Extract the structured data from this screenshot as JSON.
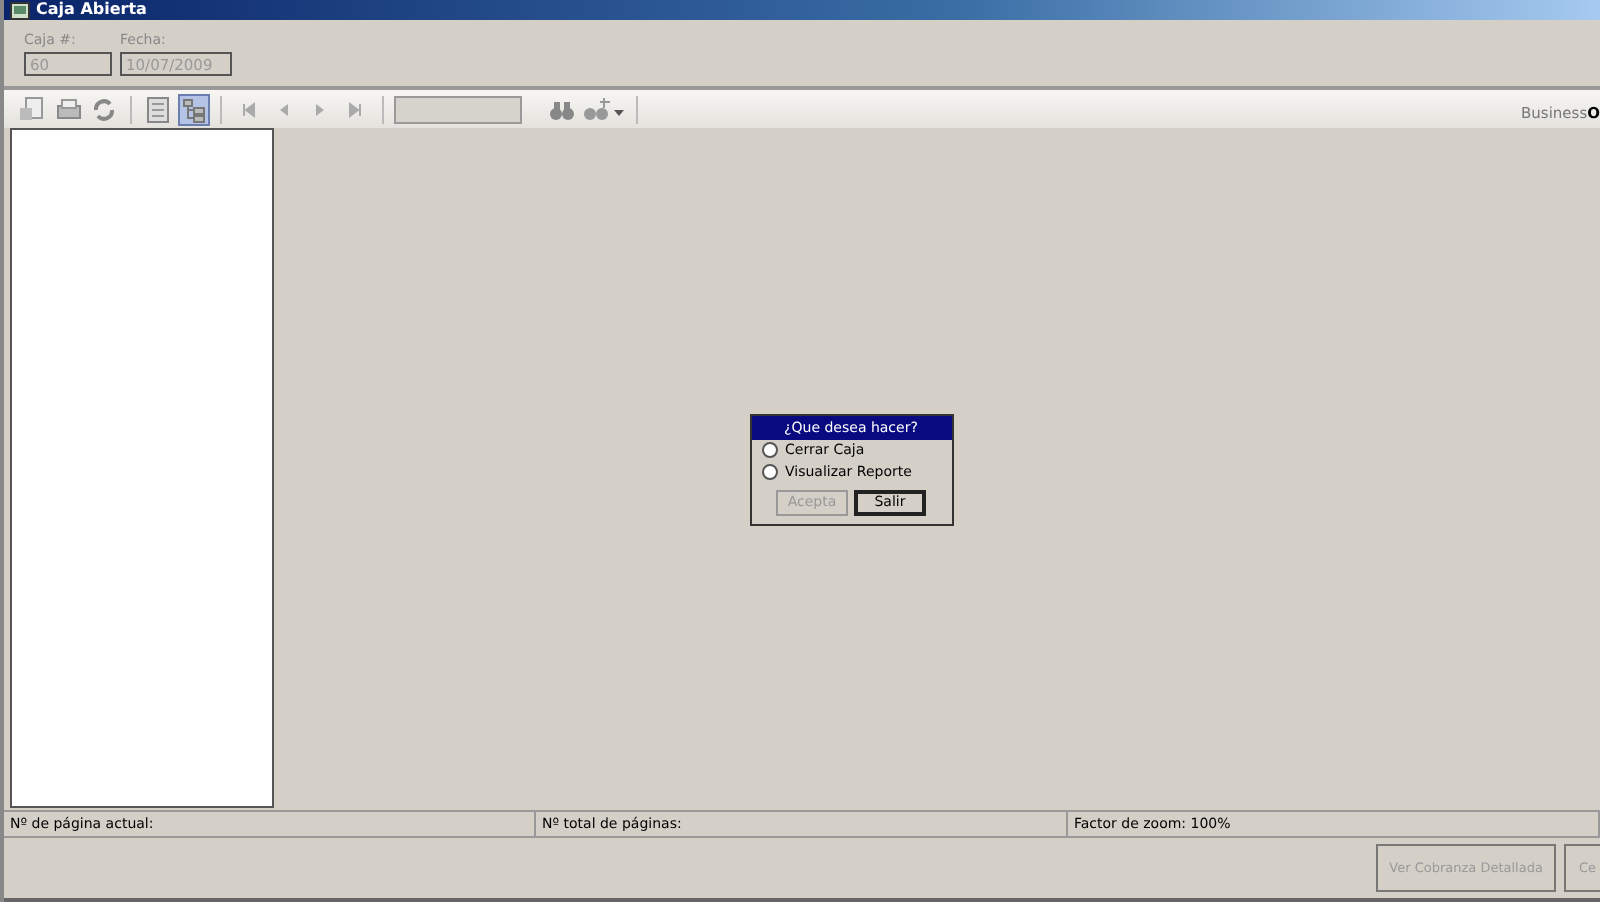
{
  "window": {
    "title": "Caja Abierta"
  },
  "header": {
    "fields": [
      {
        "label": "Caja #:",
        "value": "60"
      },
      {
        "label": "Fecha:",
        "value": "10/07/2009"
      }
    ]
  },
  "toolbar": {
    "groups": [
      [
        {
          "kind": "export",
          "selected": false
        },
        {
          "kind": "print",
          "selected": false
        },
        {
          "kind": "refresh",
          "selected": false
        }
      ],
      [
        {
          "kind": "page-setup",
          "selected": false
        },
        {
          "kind": "tree",
          "selected": true
        }
      ],
      [
        {
          "kind": "first",
          "selected": false
        },
        {
          "kind": "prev",
          "selected": false
        },
        {
          "kind": "next",
          "selected": false
        },
        {
          "kind": "last",
          "selected": false
        }
      ]
    ],
    "search_buttons": [
      {
        "kind": "binoculars"
      },
      {
        "kind": "zoom"
      }
    ],
    "brand": "Business**O**"
  },
  "dialog": {
    "title": "¿Que desea hacer?",
    "options": [
      {
        "label": "Cerrar Caja",
        "selected": false
      },
      {
        "label": "Visualizar Reporte",
        "selected": false
      }
    ],
    "buttons": [
      {
        "label": "Acepta",
        "disabled": true
      },
      {
        "label": "Salir",
        "disabled": false
      }
    ]
  },
  "status_bar": [
    "Nº de página actual:",
    "Nº total de páginas:",
    "Factor de zoom: 100%"
  ],
  "buttons": [
    {
      "label": "Ver Cobranza Detallada"
    },
    {
      "label": "Ce"
    }
  ]
}
